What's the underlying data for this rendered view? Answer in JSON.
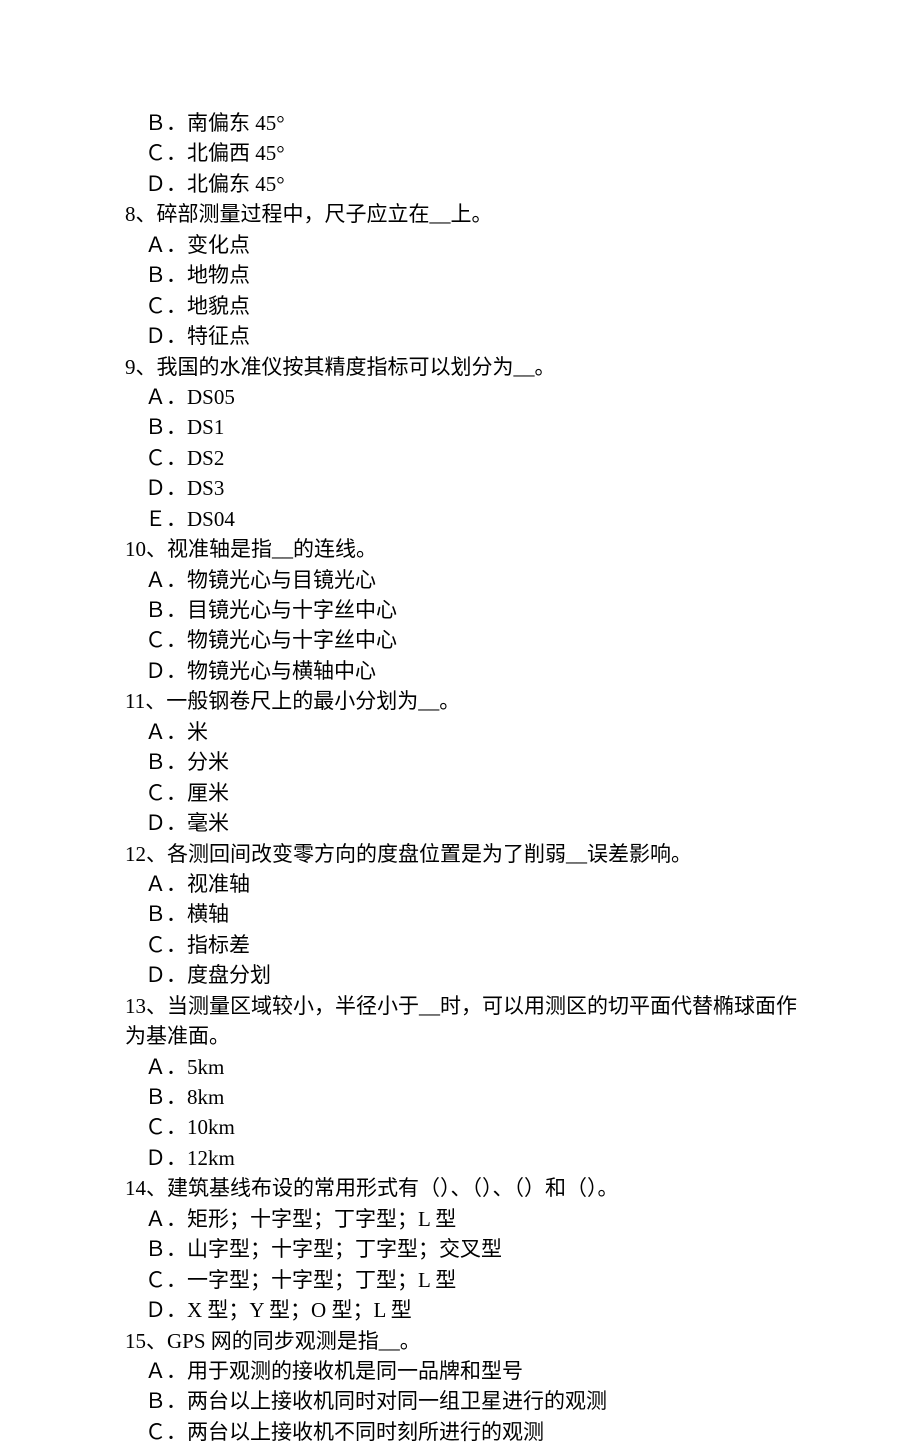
{
  "lines": [
    {
      "cls": "option",
      "text": "Ｂ．南偏东 45°"
    },
    {
      "cls": "option",
      "text": "Ｃ．北偏西 45°"
    },
    {
      "cls": "option",
      "text": "Ｄ．北偏东 45°"
    },
    {
      "cls": "question",
      "text": "8、碎部测量过程中，尺子应立在__上。"
    },
    {
      "cls": "option",
      "text": "Ａ．变化点"
    },
    {
      "cls": "option",
      "text": "Ｂ．地物点"
    },
    {
      "cls": "option",
      "text": "Ｃ．地貌点"
    },
    {
      "cls": "option",
      "text": "Ｄ．特征点"
    },
    {
      "cls": "question",
      "text": "9、我国的水准仪按其精度指标可以划分为__。"
    },
    {
      "cls": "option",
      "text": "Ａ．DS05"
    },
    {
      "cls": "option",
      "text": "Ｂ．DS1"
    },
    {
      "cls": "option",
      "text": "Ｃ．DS2"
    },
    {
      "cls": "option",
      "text": "Ｄ．DS3"
    },
    {
      "cls": "option",
      "text": "Ｅ．DS04"
    },
    {
      "cls": "question",
      "text": "10、视准轴是指__的连线。"
    },
    {
      "cls": "option",
      "text": "Ａ．物镜光心与目镜光心"
    },
    {
      "cls": "option",
      "text": "Ｂ．目镜光心与十字丝中心"
    },
    {
      "cls": "option",
      "text": "Ｃ．物镜光心与十字丝中心"
    },
    {
      "cls": "option",
      "text": "Ｄ．物镜光心与横轴中心"
    },
    {
      "cls": "question",
      "text": "11、一般钢卷尺上的最小分划为__。"
    },
    {
      "cls": "option",
      "text": "Ａ．米"
    },
    {
      "cls": "option",
      "text": "Ｂ．分米"
    },
    {
      "cls": "option",
      "text": "Ｃ．厘米"
    },
    {
      "cls": "option",
      "text": "Ｄ．毫米"
    },
    {
      "cls": "question",
      "text": "12、各测回间改变零方向的度盘位置是为了削弱__误差影响。"
    },
    {
      "cls": "option",
      "text": "Ａ．视准轴"
    },
    {
      "cls": "option",
      "text": "Ｂ．横轴"
    },
    {
      "cls": "option",
      "text": "Ｃ．指标差"
    },
    {
      "cls": "option",
      "text": "Ｄ．度盘分划"
    },
    {
      "cls": "question",
      "text": "13、当测量区域较小，半径小于__时，可以用测区的切平面代替椭球面作为基准面。"
    },
    {
      "cls": "option",
      "text": "Ａ．5km"
    },
    {
      "cls": "option",
      "text": "Ｂ．8km"
    },
    {
      "cls": "option",
      "text": "Ｃ．10km"
    },
    {
      "cls": "option",
      "text": "Ｄ．12km"
    },
    {
      "cls": "question",
      "text": "14、建筑基线布设的常用形式有（）、（）、（）和（）。"
    },
    {
      "cls": "option",
      "text": "Ａ．矩形；十字型；丁字型；L 型"
    },
    {
      "cls": "option",
      "text": "Ｂ．山字型；十字型；丁字型；交叉型"
    },
    {
      "cls": "option",
      "text": "Ｃ．一字型；十字型；丁型；L 型"
    },
    {
      "cls": "option",
      "text": "Ｄ．X 型；Y 型；O 型；L 型"
    },
    {
      "cls": "question",
      "text": "15、GPS 网的同步观测是指__。"
    },
    {
      "cls": "option",
      "text": "Ａ．用于观测的接收机是同一品牌和型号"
    },
    {
      "cls": "option",
      "text": "Ｂ．两台以上接收机同时对同一组卫星进行的观测"
    },
    {
      "cls": "option",
      "text": "Ｃ．两台以上接收机不同时刻所进行的观测"
    }
  ]
}
